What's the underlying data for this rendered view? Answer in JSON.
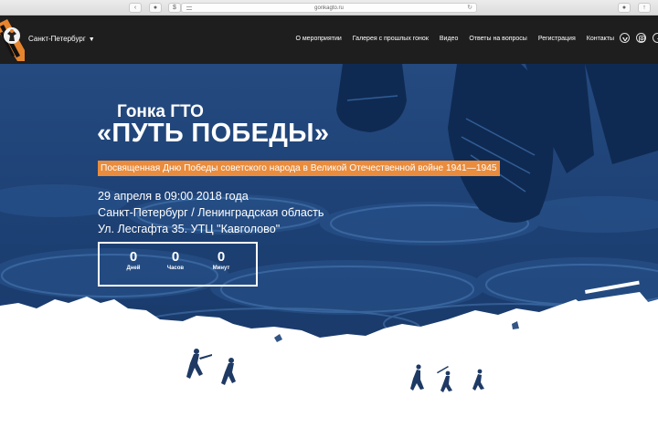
{
  "browser": {
    "url": "gonkagto.ru",
    "buttons": [
      "‹",
      "●",
      "$"
    ]
  },
  "header": {
    "city": "Санкт-Петербург",
    "city_caret": "▼",
    "nav": [
      "О мероприятии",
      "Галерея с прошлых гонок",
      "Видео",
      "Ответы на вопросы",
      "Регистрация",
      "Контакты"
    ],
    "social_icons": [
      "vk-icon",
      "instagram-icon",
      "facebook-icon"
    ]
  },
  "hero": {
    "title_small": "Гонка ГТО",
    "title_main": "«ПУТЬ ПОБЕДЫ»",
    "subtitle": "Посвященная Дню Победы советского народа в Великой Отечественной войне 1941—1945",
    "date": "29 апреля в 09:00 2018 года",
    "location": "Санкт-Петербург / Ленинградская область",
    "address": "Ул. Лесгафта 35. УТЦ \"Кавголово\"",
    "countdown": [
      {
        "value": "0",
        "label": "Дней"
      },
      {
        "value": "0",
        "label": "Часов"
      },
      {
        "value": "0",
        "label": "Минут"
      }
    ]
  },
  "colors": {
    "header_bg": "#1e1e1e",
    "hero_blue": "#1d4278",
    "accent_orange": "#e98c3d"
  }
}
